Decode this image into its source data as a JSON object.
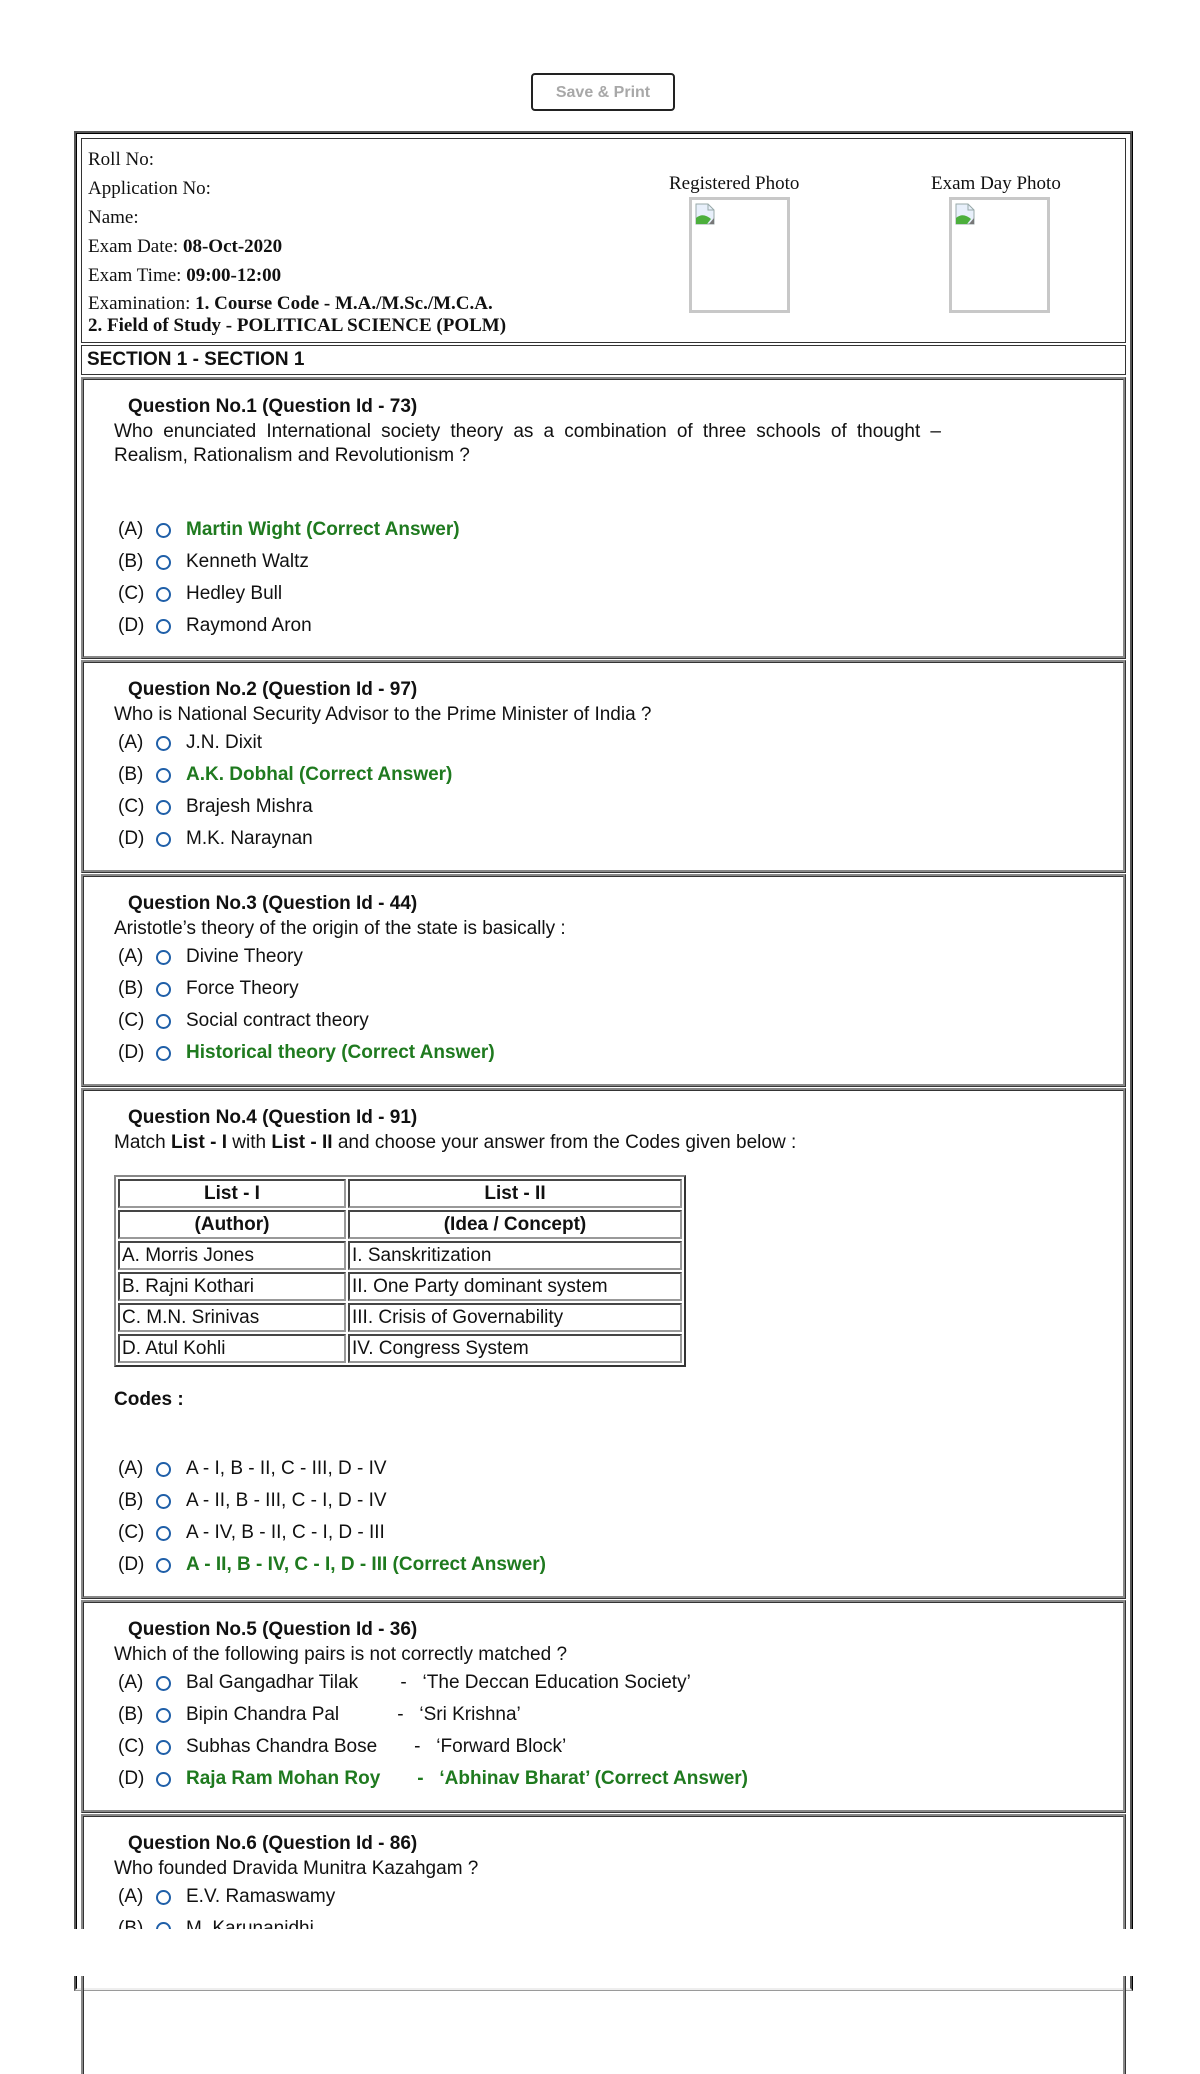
{
  "toolbar": {
    "save_print_label": "Save & Print"
  },
  "candidate": {
    "roll_no_label": "Roll No:",
    "roll_no_value": "",
    "application_no_label": "Application No:",
    "application_no_value": "",
    "name_label": "Name:",
    "name_value": "",
    "exam_date_label": "Exam Date:",
    "exam_date_value": "08-Oct-2020",
    "exam_time_label": "Exam Time:",
    "exam_time_value": "09:00-12:00",
    "examination_label": "Examination:",
    "examination_line1": "1. Course Code - M.A./M.Sc./M.C.A.",
    "examination_line2": "2. Field of Study - POLITICAL SCIENCE (POLM)"
  },
  "photos": {
    "registered_label": "Registered Photo",
    "exam_day_label": "Exam Day Photo"
  },
  "section": {
    "title": "SECTION 1 - SECTION 1"
  },
  "colors": {
    "correct": "#1f7a1f",
    "radio": "#1f5fa8"
  },
  "questions": [
    {
      "title": "Question No.1 (Question Id - 73)",
      "text": "Who enunciated International society theory as a combination of three schools of thought – Realism, Rationalism and Revolutionism ?",
      "options": [
        {
          "label": "(A)",
          "text": "Martin Wight (Correct Answer)",
          "correct": true
        },
        {
          "label": "(B)",
          "text": "Kenneth Waltz",
          "correct": false
        },
        {
          "label": "(C)",
          "text": "Hedley Bull",
          "correct": false
        },
        {
          "label": "(D)",
          "text": "Raymond Aron",
          "correct": false
        }
      ]
    },
    {
      "title": "Question No.2 (Question Id - 97)",
      "text": "Who is National Security Advisor to the Prime Minister of India ?",
      "options": [
        {
          "label": "(A)",
          "text": "J.N. Dixit",
          "correct": false
        },
        {
          "label": "(B)",
          "text": "A.K. Dobhal (Correct Answer)",
          "correct": true
        },
        {
          "label": "(C)",
          "text": "Brajesh Mishra",
          "correct": false
        },
        {
          "label": "(D)",
          "text": "M.K. Naraynan",
          "correct": false
        }
      ]
    },
    {
      "title": "Question No.3 (Question Id - 44)",
      "text": "Aristotle’s theory of the origin of the state is basically :",
      "options": [
        {
          "label": "(A)",
          "text": "Divine Theory",
          "correct": false
        },
        {
          "label": "(B)",
          "text": "Force Theory",
          "correct": false
        },
        {
          "label": "(C)",
          "text": "Social contract theory",
          "correct": false
        },
        {
          "label": "(D)",
          "text": "Historical theory (Correct Answer)",
          "correct": true
        }
      ]
    },
    {
      "title": "Question No.4 (Question Id - 91)",
      "text_parts": [
        "Match ",
        "List - I",
        " with ",
        "List - II",
        " and choose your answer from the Codes given below :"
      ],
      "table": {
        "headers": [
          "List - I",
          "List - II"
        ],
        "subheaders": [
          "(Author)",
          "(Idea / Concept)"
        ],
        "rows": [
          [
            "A.  Morris Jones",
            "I.  Sanskritization"
          ],
          [
            "B.  Rajni Kothari",
            "II.  One Party dominant system"
          ],
          [
            "C.  M.N. Srinivas",
            "III.  Crisis of Governability"
          ],
          [
            "D.  Atul Kohli",
            "IV.  Congress System"
          ]
        ]
      },
      "codes_label": "Codes :",
      "options": [
        {
          "label": "(A)",
          "text": "A - I, B - II, C - III, D - IV",
          "correct": false
        },
        {
          "label": "(B)",
          "text": "A - II, B - III, C - I, D - IV",
          "correct": false
        },
        {
          "label": "(C)",
          "text": "A - IV, B - II, C - I, D - III",
          "correct": false
        },
        {
          "label": "(D)",
          "text": "A - II, B - IV, C - I, D - III (Correct Answer)",
          "correct": true
        }
      ]
    },
    {
      "title": "Question No.5 (Question Id - 36)",
      "text": "Which of the following pairs is not correctly matched ?",
      "options": [
        {
          "label": "(A)",
          "text": "Bal Gangadhar Tilak        -   ‘The Deccan Education Society’",
          "correct": false
        },
        {
          "label": "(B)",
          "text": "Bipin Chandra Pal           -   ‘Sri Krishna’",
          "correct": false
        },
        {
          "label": "(C)",
          "text": "Subhas Chandra Bose       -   ‘Forward Block’",
          "correct": false
        },
        {
          "label": "(D)",
          "text": "Raja Ram Mohan Roy       -   ‘Abhinav Bharat’ (Correct Answer)",
          "correct": true
        }
      ]
    },
    {
      "title": "Question No.6 (Question Id - 86)",
      "text": "Who founded Dravida Munitra Kazahgam ?",
      "options": [
        {
          "label": "(A)",
          "text": "E.V. Ramaswamy",
          "correct": false
        },
        {
          "label": "(B)",
          "text": "M. Karunanidhi",
          "correct": false
        }
      ]
    }
  ]
}
